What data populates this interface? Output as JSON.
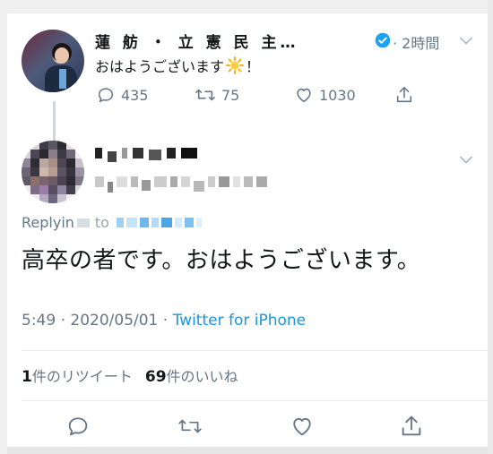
{
  "parent_tweet": {
    "display_name": "蓮 舫 ・ 立 憲 民 主…",
    "time": "· 2時間",
    "text_before_emoji": "おはようございます",
    "text_after_emoji": "！",
    "emoji": "sun-emoji",
    "counts": {
      "replies": "435",
      "retweets": "75",
      "likes": "1030"
    }
  },
  "reply_tweet": {
    "replying_label": "Replyin",
    "replying_to_fragment": "to",
    "text": "高卒の者です。おはようございます。",
    "meta_time": "5:49 · 2020/05/01 · ",
    "meta_source": "Twitter for iPhone"
  },
  "stats": {
    "retweets_count": "1",
    "retweets_label": "件のリツイート",
    "likes_count": "69",
    "likes_label": "件のいいね"
  },
  "colors": {
    "accent": "#1b95e0",
    "secondary_text": "#657786",
    "primary_text": "#14171a",
    "verified": "#1da1f2"
  }
}
